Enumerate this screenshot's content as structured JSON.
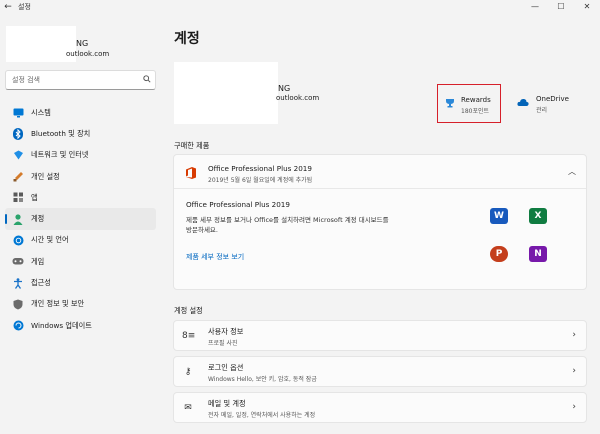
{
  "window": {
    "title": "설정",
    "back_glyph": "←",
    "controls": [
      "—",
      "☐",
      "✕"
    ]
  },
  "sidebar": {
    "profile": {
      "name_fragment": "NG",
      "email_fragment": "outlook.com"
    },
    "search": {
      "placeholder": "설정 검색",
      "icon": "search-icon"
    },
    "items": [
      {
        "label": "시스템",
        "icon": "monitor-icon",
        "color": "#0078d4"
      },
      {
        "label": "Bluetooth 및 장치",
        "icon": "bluetooth-icon",
        "color": "#0067c0"
      },
      {
        "label": "네트워크 및 인터넷",
        "icon": "network-icon",
        "color": "#1f8fe6"
      },
      {
        "label": "개인 설정",
        "icon": "brush-icon",
        "color": "#d47b2a"
      },
      {
        "label": "앱",
        "icon": "apps-icon",
        "color": "#5a5a5a"
      },
      {
        "label": "계정",
        "icon": "person-icon",
        "color": "#2aa36b",
        "active": true
      },
      {
        "label": "시간 및 언어",
        "icon": "globe-clock-icon",
        "color": "#0078d4"
      },
      {
        "label": "게임",
        "icon": "gamepad-icon",
        "color": "#6b6b6b"
      },
      {
        "label": "접근성",
        "icon": "accessibility-icon",
        "color": "#1a73c9"
      },
      {
        "label": "개인 정보 및 보안",
        "icon": "shield-icon",
        "color": "#6b6b6b"
      },
      {
        "label": "Windows 업데이트",
        "icon": "windows-update-icon",
        "color": "#0078d4"
      }
    ]
  },
  "main": {
    "title": "계정",
    "account": {
      "name_fragment": "NG",
      "email_fragment": "outlook.com"
    },
    "rewards": {
      "title": "Rewards",
      "subtitle": "180포인트"
    },
    "onedrive": {
      "title": "OneDrive",
      "subtitle": "관리"
    },
    "purchased_label": "구매한 제품",
    "product": {
      "head_title": "Office Professional Plus 2019",
      "head_subtitle": "2019년 5월 6일 월요일에 계정에 추가됨",
      "name": "Office Professional Plus 2019",
      "description": "제품 세부 정보를 보거나 Office를 설치하려면 Microsoft 계정 대시보드를 방문하세요.",
      "link": "제품 세부 정보 보기",
      "apps": [
        {
          "letter": "W",
          "name": "word-icon",
          "color": "#185abd"
        },
        {
          "letter": "X",
          "name": "excel-icon",
          "color": "#107c41"
        },
        {
          "letter": "P",
          "name": "powerpoint-icon",
          "color": "#c43e1c"
        },
        {
          "letter": "N",
          "name": "onenote-icon",
          "color": "#7719aa"
        }
      ]
    },
    "settings_label": "계정 설정",
    "settings": [
      {
        "title": "사용자 정보",
        "subtitle": "프로필 사진",
        "glyph": "8≡",
        "icon": "user-info-icon"
      },
      {
        "title": "로그인 옵션",
        "subtitle": "Windows Hello, 보안 키, 암호, 동적 잠금",
        "glyph": "⚷",
        "icon": "key-icon"
      },
      {
        "title": "메일 및 계정",
        "subtitle": "전자 메일, 일정, 연락처에서 사용하는 계정",
        "glyph": "✉",
        "icon": "mail-icon"
      }
    ],
    "chevron_right": "›",
    "chevron_up": "︿"
  }
}
